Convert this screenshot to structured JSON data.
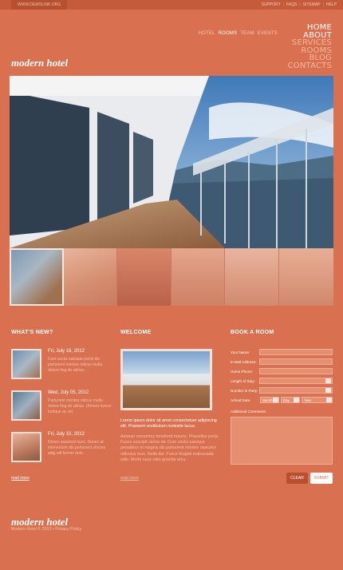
{
  "topbar": {
    "url": "WWW.DEMOLINK.ORG",
    "links": [
      "SUPPORT",
      "FAQS",
      "SITEMAP",
      "HELP"
    ]
  },
  "subnav": [
    {
      "label": "HOTEL",
      "active": false
    },
    {
      "label": "ROOMS",
      "active": true
    },
    {
      "label": "TEAM",
      "active": false
    },
    {
      "label": "EVENTS",
      "active": false
    }
  ],
  "mainnav": [
    {
      "label": "HOME",
      "active": true
    },
    {
      "label": "ABOUT",
      "active": true
    },
    {
      "label": "SERVICES",
      "active": false
    },
    {
      "label": "ROOMS",
      "active": false
    },
    {
      "label": "BLOG",
      "active": false
    },
    {
      "label": "CONTACTS",
      "active": false
    }
  ],
  "logo": "modern hotel",
  "news": {
    "title": "WHAT'S NEW?",
    "items": [
      {
        "date": "Fri, July 18, 2012",
        "text": "Cum sociis natoque penis dis parturient montes ridicus mulla dolore fing do ultrice."
      },
      {
        "date": "Wed, July 05, 2012",
        "text": "Parturient montes ridicus mulla dolore fing do ultrice. Ultrices lorens tortique ac vel."
      },
      {
        "date": "Fri, July 10, 2012",
        "text": "Donec euismod nunc. Donec at elementum dis parturient ultrices adig elit fermm dolo."
      }
    ],
    "read_more": "read more"
  },
  "welcome": {
    "title": "WELCOME",
    "lead": "Lorem ipsum dolor sit amet consectetuer adipiscing elit. Praesent vestibulum molestie lacus.",
    "body": "Aenean nonummy hendrerit mauris. Phasellus porta. Fusce suscipit varius mi. Cum sociis natoque penatibus et magnis dis parturient montes nascetur ridiculus mus. Nulla dui. Fusce feugiat malesuada odio. Morbi nunc odio gravida arcu.",
    "read_more": "read more"
  },
  "booking": {
    "title": "BOOK A ROOM",
    "labels": {
      "name": "Your Name:",
      "email": "E-Mail Address:",
      "phone": "Home Phone:",
      "length": "Length of Stay:",
      "party": "Number in Party:",
      "arrival": "Arrival Date:",
      "comments": "Additional Comments:"
    },
    "month": "Month",
    "day": "Day",
    "year": "Year",
    "clear": "CLEAR",
    "submit": "SUBMIT"
  },
  "footer": {
    "logo": "modern hotel",
    "copyright": "Modern Hotel © 2012 • Privacy Policy"
  },
  "colors": {
    "bg": "#d9704f",
    "accent": "#b6502f",
    "text_light": "#f4c3ae"
  }
}
